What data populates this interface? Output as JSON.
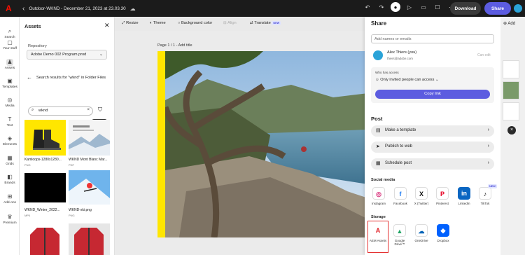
{
  "topbar": {
    "title": "Outdoor-WKND - December 21, 2023 at 23.03.30",
    "download": "Download",
    "share": "Share"
  },
  "rail": [
    {
      "label": "Search",
      "icon": "search-icon"
    },
    {
      "label": "Your stuff",
      "icon": "folder-icon"
    },
    {
      "label": "Assets",
      "icon": "assets-icon"
    },
    {
      "label": "Templates",
      "icon": "templates-icon"
    },
    {
      "label": "Media",
      "icon": "media-icon"
    },
    {
      "label": "Text",
      "icon": "text-icon"
    },
    {
      "label": "Elements",
      "icon": "elements-icon"
    },
    {
      "label": "Grids",
      "icon": "grids-icon"
    },
    {
      "label": "Brands",
      "icon": "brands-icon"
    },
    {
      "label": "Add-ons",
      "icon": "addons-icon"
    },
    {
      "label": "Premium",
      "icon": "premium-icon"
    }
  ],
  "assets": {
    "title": "Assets",
    "repo_label": "Repository",
    "repo_value": "Adobe Demo 002 Program prod",
    "search_title": "Search results for \"wknd\" in Folder Files",
    "search_value": "wknd",
    "items": [
      {
        "name": "Kamloops-1280x1280...",
        "type": "PNG"
      },
      {
        "name": "WKND Mont Blanc Mar...",
        "type": "PDF"
      },
      {
        "name": "WKND_Winter_2022...",
        "type": "MP4"
      },
      {
        "name": "WKND-ski.png",
        "type": "PNG"
      }
    ]
  },
  "toolbar": {
    "resize": "Resize",
    "theme": "Theme",
    "background": "Background color",
    "align": "Align",
    "translate": "Translate",
    "new": "NEW"
  },
  "canvas": {
    "page_label": "Page 1 / 1 - Add title"
  },
  "share_panel": {
    "title": "Share",
    "names_placeholder": "Add names or emails",
    "user_name": "Alex Thiers (you)",
    "user_email": "thiers@adobe.com",
    "can_edit": "Can edit",
    "who_access": "Who has access",
    "access_value": "Only invited people can access",
    "copy_link": "Copy link",
    "post_title": "Post",
    "post_rows": [
      "Make a template",
      "Publish to web",
      "Schedule post"
    ],
    "social_title": "Social media",
    "social": [
      "Instagram",
      "Facebook",
      "X (Twitter)",
      "Pinterest",
      "LinkedIn",
      "TikTok"
    ],
    "social_new": "NEW",
    "storage_title": "Storage",
    "storage": [
      "AEM Assets",
      "Google Drive™",
      "OneDrive",
      "Dropbox"
    ]
  },
  "right": {
    "add": "Add"
  },
  "colors": {
    "accent": "#5c5ce0",
    "highlight": "#ffe600",
    "topbar": "#1b1b1b"
  }
}
